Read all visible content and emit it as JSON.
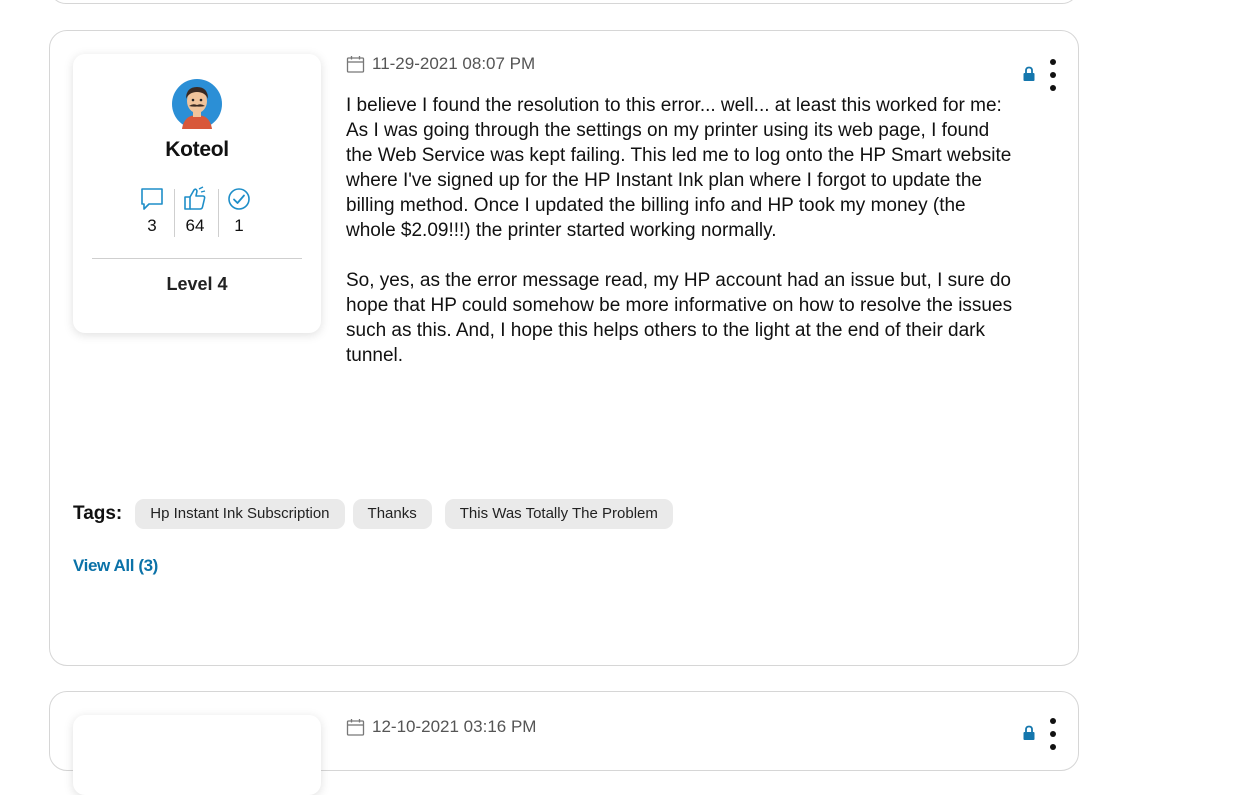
{
  "post": {
    "author": {
      "name": "Koteol",
      "stats": {
        "replies": "3",
        "kudos": "64",
        "solutions": "1"
      },
      "level": "Level 4"
    },
    "date": "11-29-2021 08:07 PM",
    "body": [
      "I believe I found the resolution to this error... well... at least this worked for me:\nAs I was going through the settings on my printer using its web page, I found the Web Service was kept failing.  This led me to log onto the HP Smart website where I've signed up for the HP Instant Ink plan where I forgot to update the billing method.  Once I updated the billing info and HP took my money (the whole $2.09!!!) the printer started working normally.",
      "So, yes, as the error message read, my HP account had an issue but, I sure do hope that HP could somehow be more informative on how to resolve the issues such as this.  And, I hope this helps others to the light at the end of their dark tunnel."
    ],
    "tags_label": "Tags:",
    "tags": [
      "Hp Instant Ink Subscription",
      "Thanks",
      "This Was Totally The Problem"
    ],
    "view_all": "View All (3)"
  },
  "next_post": {
    "date": "12-10-2021 03:16 PM"
  },
  "icons": {
    "calendar": "calendar-icon",
    "lock": "lock-icon",
    "menu": "more-options-icon",
    "replies": "chat-bubble-icon",
    "kudos": "thumbs-up-icon",
    "solutions": "check-circle-icon"
  },
  "colors": {
    "accent": "#0b72a8",
    "stat_icon": "#1e8ec8",
    "tag_bg": "#eaeaea",
    "card_border": "#d6d6d6"
  }
}
